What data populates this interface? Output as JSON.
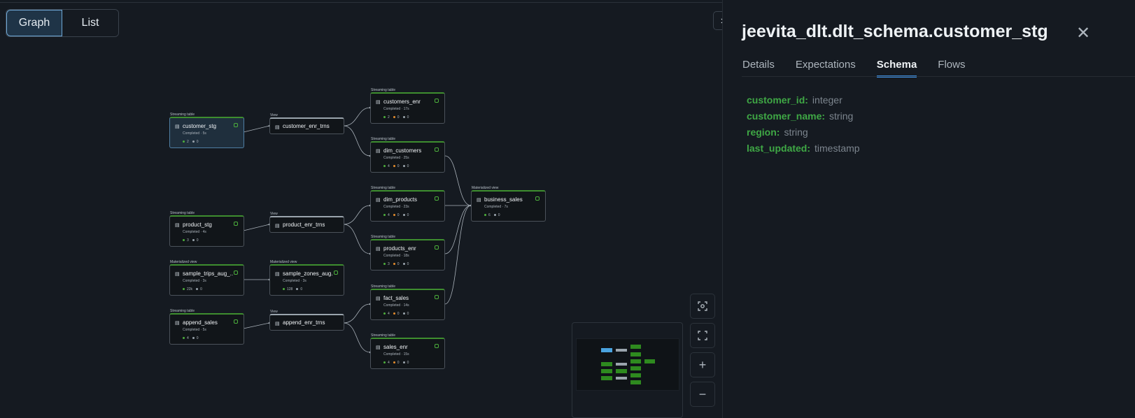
{
  "view_toggle": {
    "graph_label": "Graph",
    "list_label": "List",
    "selected": "Graph"
  },
  "graph": {
    "nodes": [
      {
        "id": "customer_stg",
        "type": "Streaming table",
        "name": "customer_stg",
        "status": "Completed · 5s",
        "stats": [
          "2",
          "0"
        ],
        "selected": true
      },
      {
        "id": "customer_enr_trns",
        "type": "View",
        "name": "customer_enr_trns",
        "status": "",
        "stats": []
      },
      {
        "id": "customers_enr",
        "type": "Streaming table",
        "name": "customers_enr",
        "status": "Completed · 17s",
        "stats": [
          "2",
          "0",
          "0"
        ]
      },
      {
        "id": "dim_customers",
        "type": "Streaming table",
        "name": "dim_customers",
        "status": "Completed · 25s",
        "stats": [
          "4",
          "0",
          "0"
        ]
      },
      {
        "id": "product_stg",
        "type": "Streaming table",
        "name": "product_stg",
        "status": "Completed · 4s",
        "stats": [
          "3",
          "0"
        ]
      },
      {
        "id": "product_enr_trns",
        "type": "View",
        "name": "product_enr_trns",
        "status": "",
        "stats": []
      },
      {
        "id": "dim_products",
        "type": "Streaming table",
        "name": "dim_products",
        "status": "Completed · 23s",
        "stats": [
          "4",
          "0",
          "0"
        ]
      },
      {
        "id": "products_enr",
        "type": "Streaming table",
        "name": "products_enr",
        "status": "Completed · 18s",
        "stats": [
          "3",
          "0",
          "0"
        ]
      },
      {
        "id": "business_sales",
        "type": "Materialized view",
        "name": "business_sales",
        "status": "Completed · 7s",
        "stats": [
          "6",
          "0"
        ]
      },
      {
        "id": "sample_trips_aug",
        "type": "Materialized view",
        "name": "sample_trips_aug_...",
        "status": "Completed · 3s",
        "stats": [
          "22k",
          "0"
        ]
      },
      {
        "id": "sample_zones_aug",
        "type": "Materialized view",
        "name": "sample_zones_aug...",
        "status": "Completed · 3s",
        "stats": [
          "128",
          "0"
        ]
      },
      {
        "id": "append_sales",
        "type": "Streaming table",
        "name": "append_sales",
        "status": "Completed · 5s",
        "stats": [
          "4",
          "0"
        ]
      },
      {
        "id": "append_enr_trns",
        "type": "View",
        "name": "append_enr_trns",
        "status": "",
        "stats": []
      },
      {
        "id": "fact_sales",
        "type": "Streaming table",
        "name": "fact_sales",
        "status": "Completed · 14s",
        "stats": [
          "4",
          "0",
          "0"
        ]
      },
      {
        "id": "sales_enr",
        "type": "Streaming table",
        "name": "sales_enr",
        "status": "Completed · 15s",
        "stats": [
          "4",
          "0",
          "0"
        ]
      }
    ]
  },
  "panel": {
    "title": "jeevita_dlt.dlt_schema.customer_stg",
    "tabs": [
      "Details",
      "Expectations",
      "Schema",
      "Flows"
    ],
    "active_tab": "Schema",
    "schema": [
      {
        "name": "customer_id:",
        "type": "integer"
      },
      {
        "name": "customer_name:",
        "type": "string"
      },
      {
        "name": "region:",
        "type": "string"
      },
      {
        "name": "last_updated:",
        "type": "timestamp"
      }
    ]
  },
  "colors": {
    "accent": "#3f8fe0",
    "streaming": "#3e8e2f",
    "schema_key": "#3fa845"
  },
  "icons": {
    "collapse": "chevron-right-icon",
    "close": "close-icon",
    "focus": "focus-icon",
    "fit": "fit-view-icon",
    "zoom_in": "plus-icon",
    "zoom_out": "minus-icon"
  }
}
